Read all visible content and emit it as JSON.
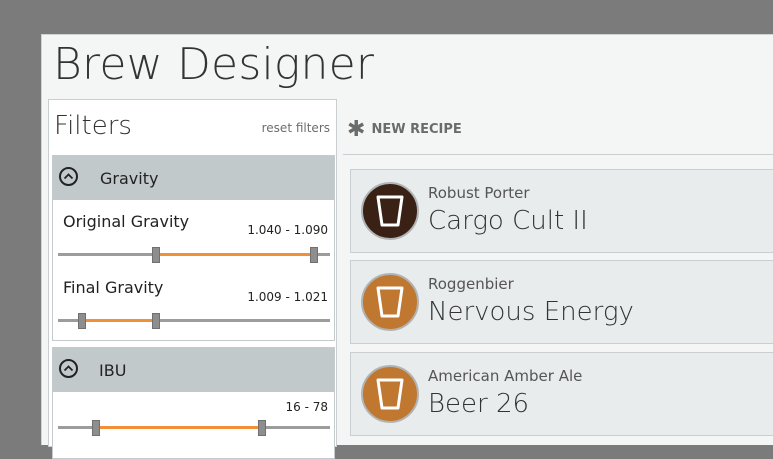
{
  "app": {
    "title": "Brew Designer"
  },
  "filters": {
    "title": "Filters",
    "reset_label": "reset filters",
    "panels": [
      {
        "title": "Gravity",
        "rows": [
          {
            "label": "Original Gravity",
            "range": "1.040 - 1.090",
            "low_fraction": 0.36,
            "high_fraction": 0.94
          },
          {
            "label": "Final Gravity",
            "range": "1.009 - 1.021",
            "low_fraction": 0.09,
            "high_fraction": 0.36
          }
        ]
      },
      {
        "title": "IBU",
        "rows": [
          {
            "label": "",
            "range": "16 - 78",
            "low_fraction": 0.14,
            "high_fraction": 0.75
          }
        ]
      }
    ]
  },
  "main": {
    "new_recipe_label": "NEW RECIPE",
    "recipes": [
      {
        "style": "Robust Porter",
        "name": "Cargo Cult II",
        "color": "#3a2116"
      },
      {
        "style": "Roggenbier",
        "name": "Nervous Energy",
        "color": "#c0772f"
      },
      {
        "style": "American Amber Ale",
        "name": "Beer 26",
        "color": "#c0772f"
      }
    ]
  },
  "colors": {
    "accent": "#f0913a",
    "panel_header": "#c2c9cb"
  }
}
